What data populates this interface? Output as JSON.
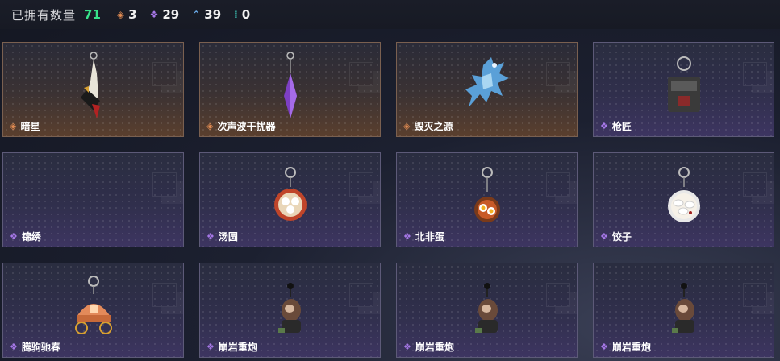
{
  "header": {
    "title": "已拥有数量",
    "total": "71",
    "stats": [
      {
        "icon": "orange-rarity-icon",
        "value": "3",
        "color": "#e08b52"
      },
      {
        "icon": "purple-rarity-icon",
        "value": "29",
        "color": "#a778e8"
      },
      {
        "icon": "blue-rarity-icon",
        "value": "39",
        "color": "#69a9e6"
      },
      {
        "icon": "teal-rarity-icon",
        "value": "0",
        "color": "#3fd0c0"
      }
    ]
  },
  "items": [
    {
      "name": "暗星",
      "rarity": "orange",
      "art": "dagger-charm-icon"
    },
    {
      "name": "次声波干扰器",
      "rarity": "orange",
      "art": "crystal-charm-icon"
    },
    {
      "name": "毁灭之源",
      "rarity": "orange",
      "art": "dragon-charm-icon"
    },
    {
      "name": "枪匠",
      "rarity": "purple",
      "art": "box-charm-icon"
    },
    {
      "name": "锦绣",
      "rarity": "purple",
      "art": ""
    },
    {
      "name": "汤圆",
      "rarity": "purple",
      "art": "bowl-charm-icon"
    },
    {
      "name": "北非蛋",
      "rarity": "purple",
      "art": "egg-charm-icon"
    },
    {
      "name": "饺子",
      "rarity": "purple",
      "art": "dumpling-charm-icon"
    },
    {
      "name": "腾驹驰春",
      "rarity": "purple",
      "art": "carriage-charm-icon"
    },
    {
      "name": "崩岩重炮",
      "rarity": "purple",
      "art": "soldier-charm-icon"
    },
    {
      "name": "崩岩重炮",
      "rarity": "purple",
      "art": "soldier-charm-icon"
    },
    {
      "name": "崩岩重炮",
      "rarity": "purple",
      "art": "soldier-charm-icon"
    }
  ]
}
